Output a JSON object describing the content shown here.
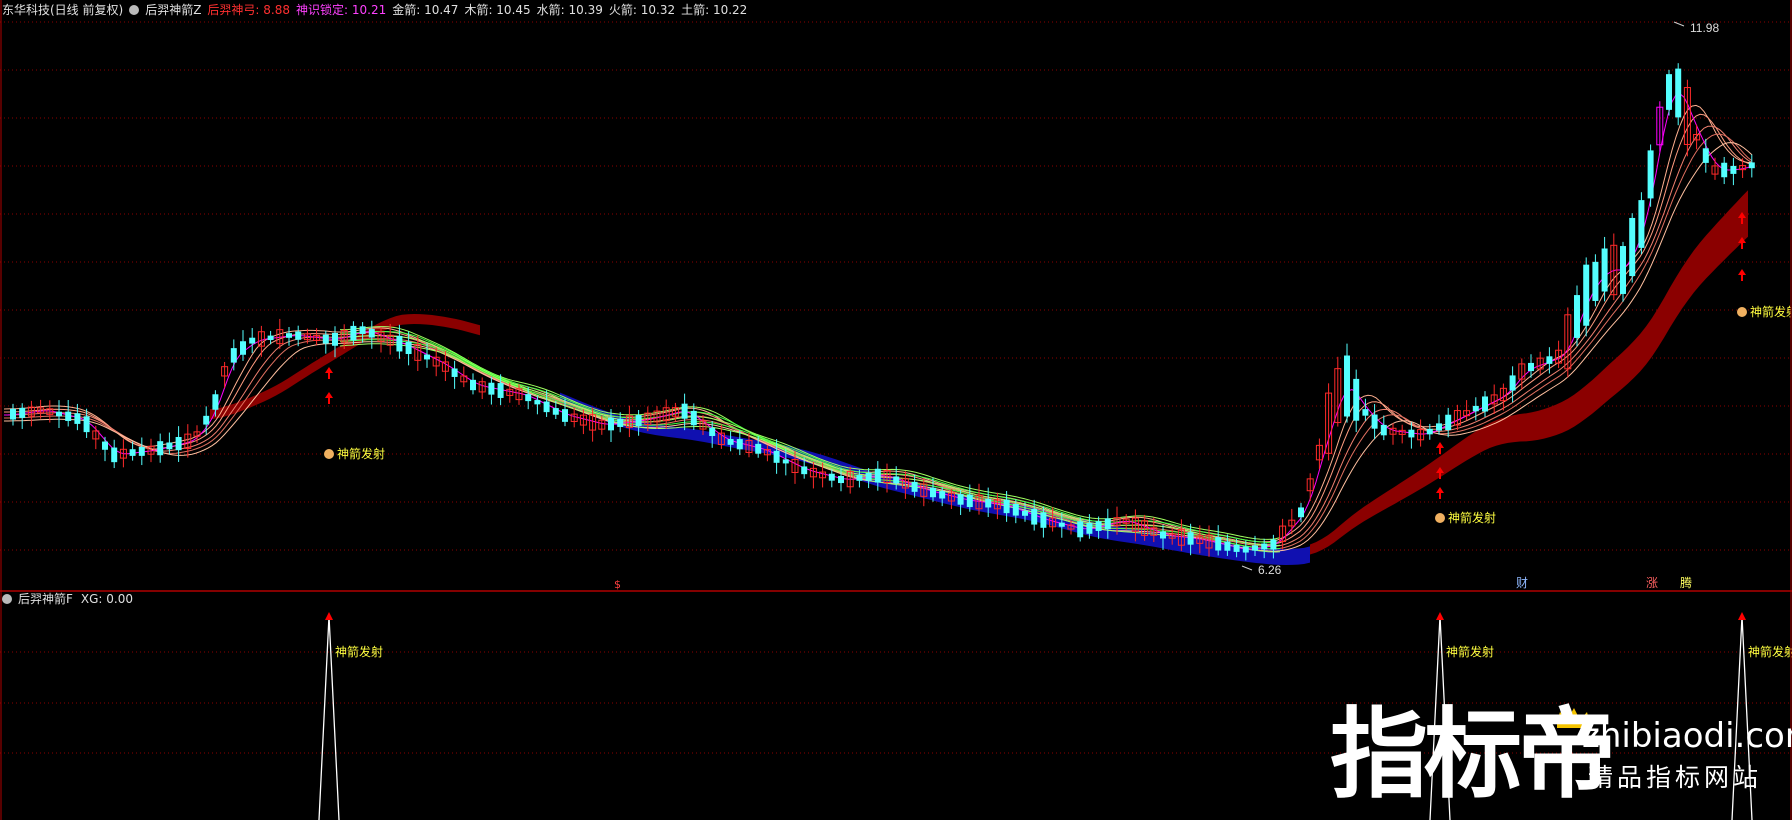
{
  "main_header": {
    "stock": "东华科技(日线 前复权)",
    "indicator": "后羿神箭Z",
    "items": [
      {
        "label": "后羿神弓: 8.88",
        "color": "#ff3030"
      },
      {
        "label": "神识锁定: 10.21",
        "color": "#ff40ff"
      },
      {
        "label": "金箭: 10.47",
        "color": "#e0e0e0"
      },
      {
        "label": "木箭: 10.45",
        "color": "#e0e0e0"
      },
      {
        "label": "水箭: 10.39",
        "color": "#e0e0e0"
      },
      {
        "label": "火箭: 10.32",
        "color": "#e0e0e0"
      },
      {
        "label": "土箭: 10.22",
        "color": "#e0e0e0"
      }
    ]
  },
  "sub_header": {
    "indicator": "后羿神箭F",
    "value": "XG: 0.00"
  },
  "annotations": {
    "high_price": "11.98",
    "low_price": "6.26",
    "signal_label": "神箭发射",
    "tag_s": "$",
    "tag_cai": "财",
    "tag_zhang": "涨",
    "tag_teng": "腾"
  },
  "watermark": {
    "main": "指标帝",
    "domain": "zhibiaodi.com",
    "slogan": "精品指标网站"
  },
  "colors": {
    "up": "#ff2a2a",
    "down": "#54ffff",
    "magenta": "#ff00ff",
    "grid": "#8b0000",
    "band_red": "#8b0000",
    "band_blue": "#1010b0",
    "label_yellow": "#ffff40",
    "signal_red": "#ff0000"
  },
  "chart_data": {
    "type": "candlestick",
    "price_high_marked": 11.98,
    "price_low_marked": 6.26,
    "signals": [
      "神箭发射",
      "神箭发射",
      "神箭发射"
    ],
    "sub_indicator": {
      "name": "XG",
      "value": 0.0,
      "spikes": 3
    }
  }
}
